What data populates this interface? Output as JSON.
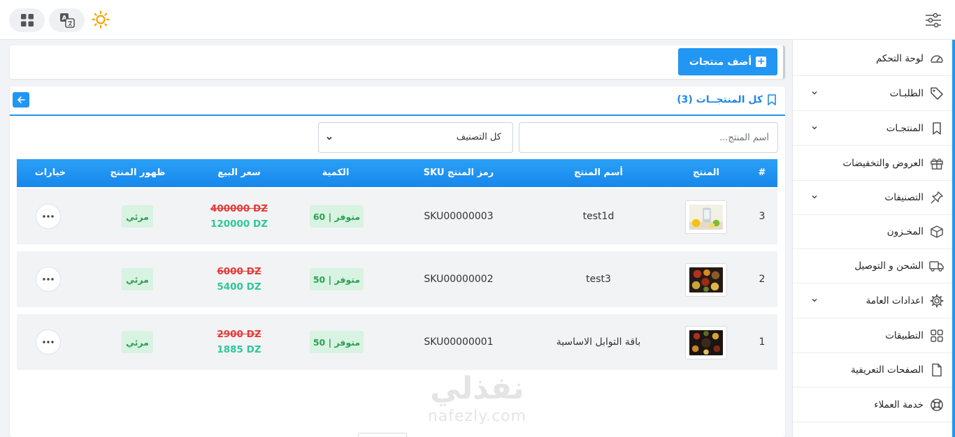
{
  "topbar": {
    "icons": [
      "apps-grid-icon",
      "translate-icon",
      "sun-icon",
      "settings-sliders-icon"
    ]
  },
  "sidebar": {
    "items": [
      {
        "label": "لوحة التحكم",
        "icon": "dashboard-gauge-icon",
        "has_submenu": false
      },
      {
        "label": "الطلبـات",
        "icon": "tag-icon",
        "has_submenu": true
      },
      {
        "label": "المنتجـات",
        "icon": "bookmark-icon",
        "has_submenu": true
      },
      {
        "label": "العروض والتخفيضات",
        "icon": "gift-icon",
        "has_submenu": false
      },
      {
        "label": "التصنيفات",
        "icon": "pin-icon",
        "has_submenu": true
      },
      {
        "label": "المخـزون",
        "icon": "box-icon",
        "has_submenu": false
      },
      {
        "label": "الشحن و التوصيل",
        "icon": "truck-icon",
        "has_submenu": false
      },
      {
        "label": "اعدادات العامة",
        "icon": "gear-icon",
        "has_submenu": true
      },
      {
        "label": "التطبيقات",
        "icon": "apps-icon",
        "has_submenu": false
      },
      {
        "label": "الصفحات التعريفية",
        "icon": "file-icon",
        "has_submenu": false
      },
      {
        "label": "خدمة العملاء",
        "icon": "support-lifebuoy-icon",
        "has_submenu": false
      }
    ]
  },
  "toolbar": {
    "add_label": "أضف منتجات"
  },
  "products": {
    "title": "كل المنتجــات (3)",
    "search_placeholder": "أسم المنتج...",
    "category_selected": "كل التصنيف",
    "columns": [
      "#",
      "المنتج",
      "أسم المنتج",
      "رمز المنتج SKU",
      "الكمية",
      "سعر البيع",
      "ظهور المنتج",
      "خيارات"
    ],
    "rows": [
      {
        "index": "3",
        "name": "test1d",
        "sku": "SKU00000003",
        "stock": "متوفر | 60",
        "old_price": "400000 DZ",
        "price": "120000 DZ",
        "visibility": "مرئي"
      },
      {
        "index": "2",
        "name": "test3",
        "sku": "SKU00000002",
        "stock": "متوفر | 50",
        "old_price": "6000 DZ",
        "price": "5400 DZ",
        "visibility": "مرئي"
      },
      {
        "index": "1",
        "name": "باقة التوابل الاساسية",
        "sku": "SKU00000001",
        "stock": "متوفر | 50",
        "old_price": "2900 DZ",
        "price": "1885 DZ",
        "visibility": "مرئي"
      }
    ]
  },
  "watermark": {
    "arabic": "نفذلي",
    "latin": "nafezly.com"
  },
  "colors": {
    "accent": "#2196f3",
    "old_price": "#e53935",
    "new_price": "#2ec79a",
    "badge_bg": "#d8f3e1",
    "badge_text": "#2e9e57"
  }
}
